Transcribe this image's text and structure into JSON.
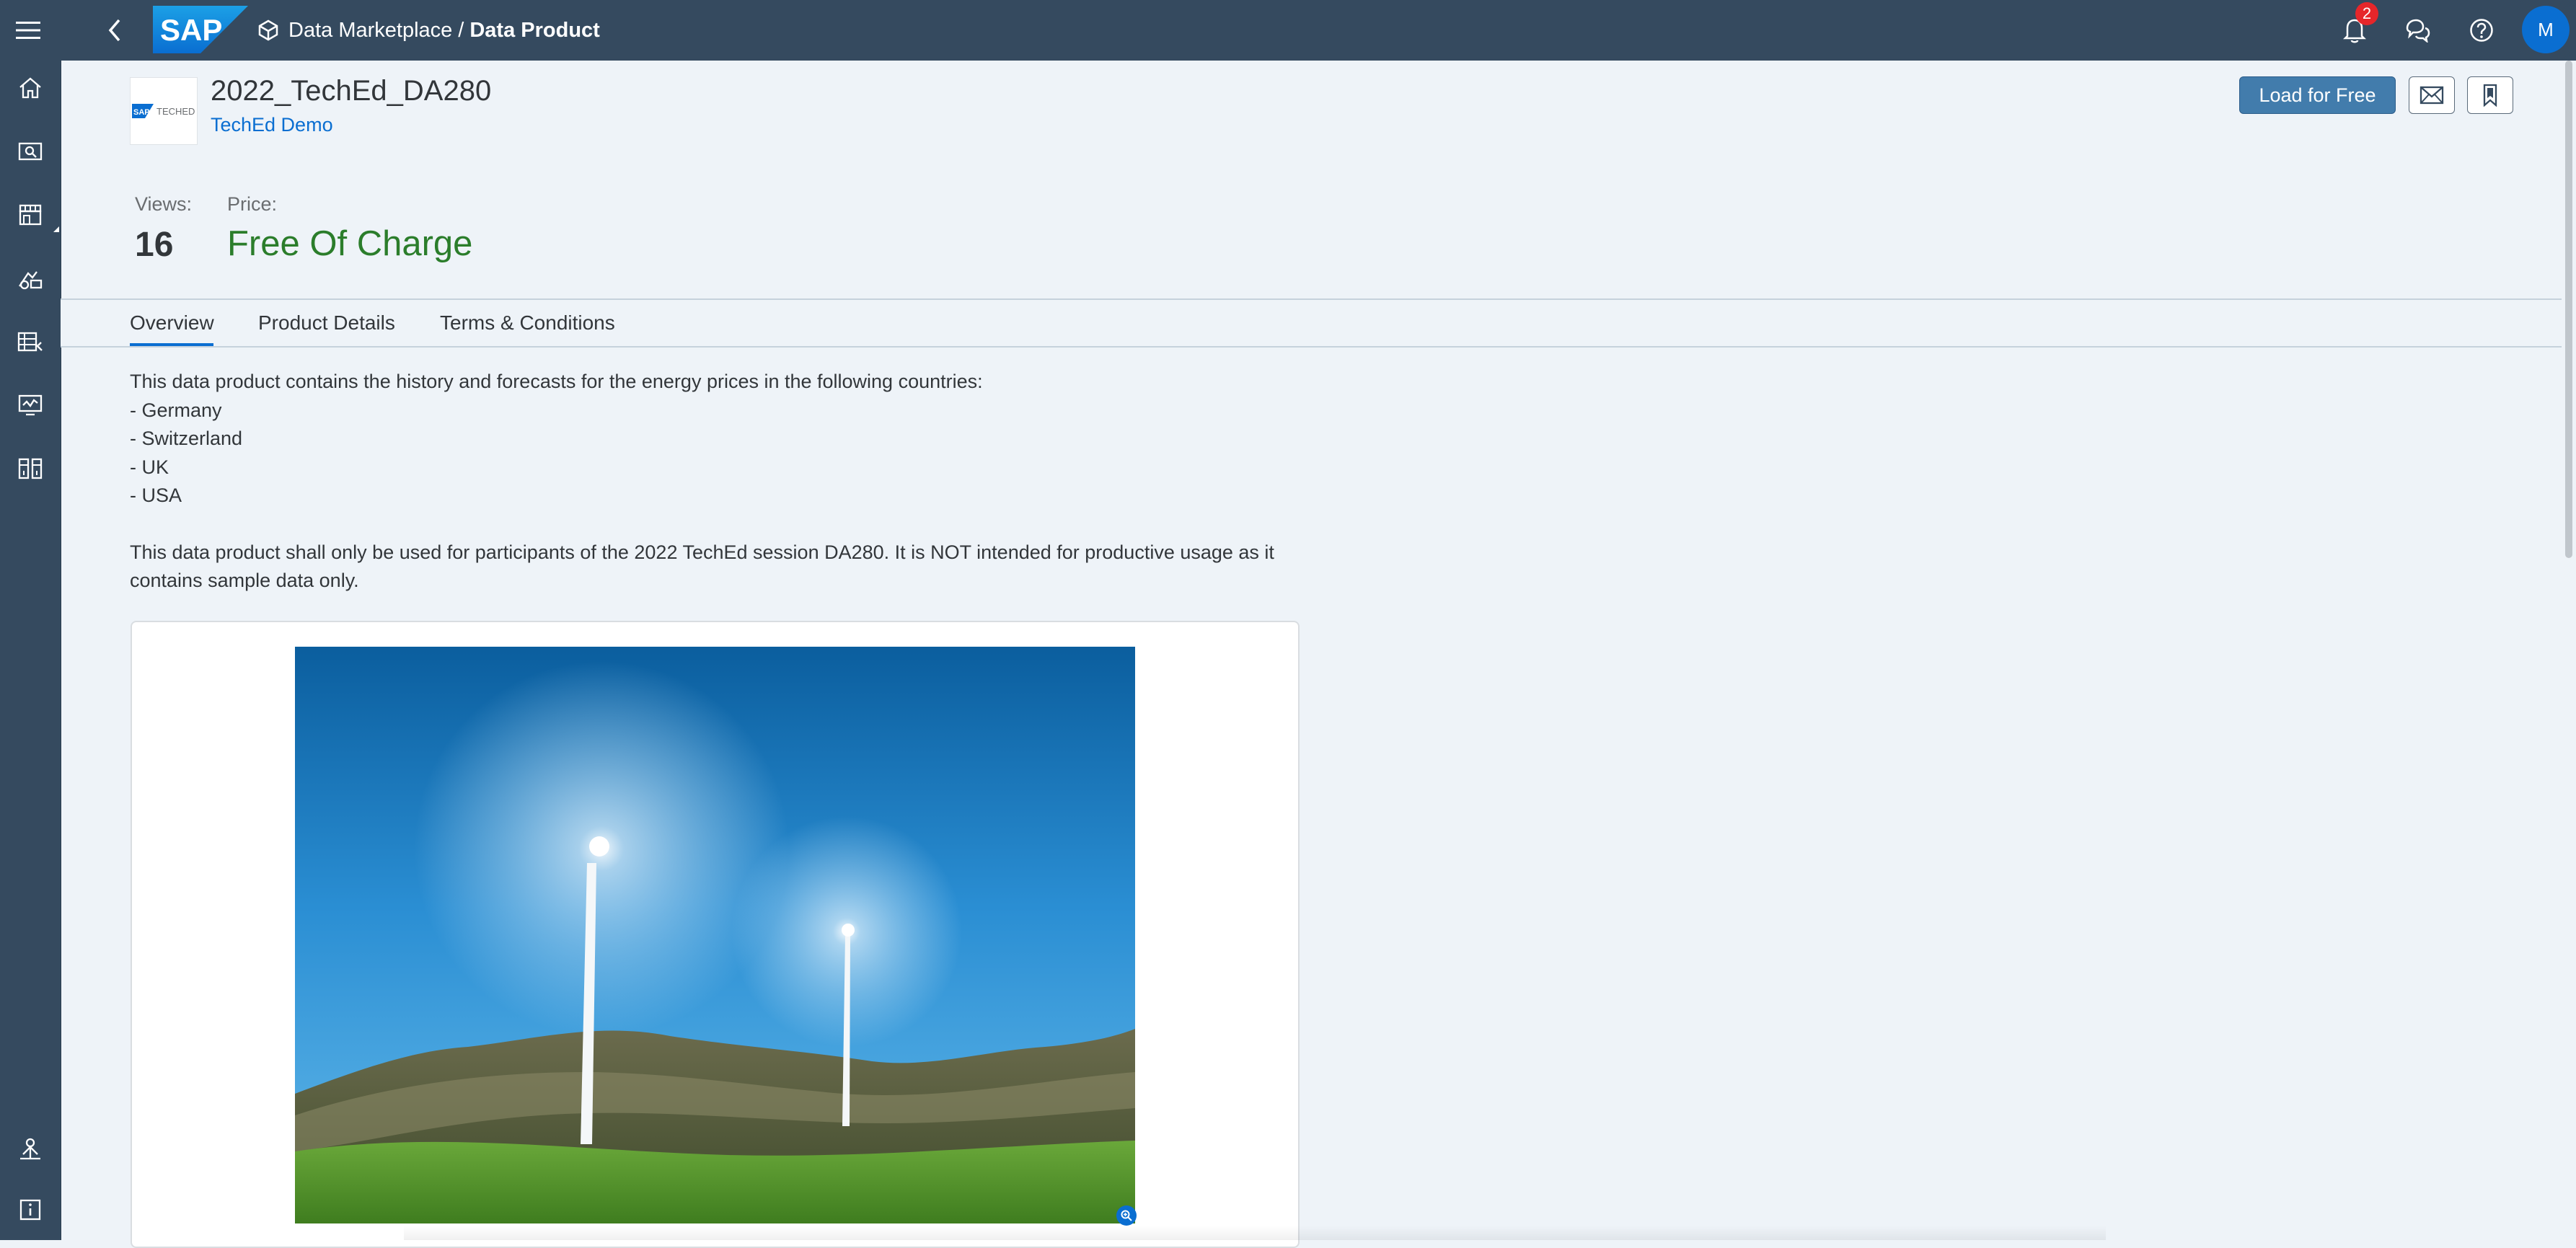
{
  "shell": {
    "logo_text": "SAP",
    "breadcrumb": {
      "parent": "Data Marketplace",
      "separator": "/",
      "current": "Data Product"
    },
    "notification_count": "2",
    "avatar_initial": "M"
  },
  "nav": {
    "items": [
      {
        "icon": "home-icon"
      },
      {
        "icon": "data-builder-search-icon"
      },
      {
        "icon": "marketplace-icon"
      },
      {
        "icon": "business-builder-icon"
      },
      {
        "icon": "data-access-icon"
      },
      {
        "icon": "monitor-icon"
      },
      {
        "icon": "connections-icon"
      },
      {
        "icon": "system-icon"
      },
      {
        "icon": "info-icon"
      }
    ]
  },
  "product": {
    "logo_text": "TECHED",
    "title": "2022_TechEd_DA280",
    "provider": "TechEd Demo",
    "load_button": "Load for Free",
    "views_label": "Views:",
    "views_value": "16",
    "price_label": "Price:",
    "price_value": "Free Of Charge"
  },
  "tabs": [
    {
      "label": "Overview",
      "selected": true
    },
    {
      "label": "Product Details",
      "selected": false
    },
    {
      "label": "Terms & Conditions",
      "selected": false
    }
  ],
  "overview": {
    "intro": "This data product contains the history and forecasts for the energy prices in the following countries:",
    "countries": [
      "- Germany",
      "- Switzerland",
      "- UK",
      "- USA"
    ],
    "note": "This data product shall only be used for participants of the 2022 TechEd session DA280. It is NOT intended for productive usage as it contains sample data only."
  },
  "colors": {
    "shell": "#354a5f",
    "accent": "#0a6ed1",
    "price": "#2b7d2b",
    "load_button": "#427cac",
    "badge": "#e6262a"
  }
}
